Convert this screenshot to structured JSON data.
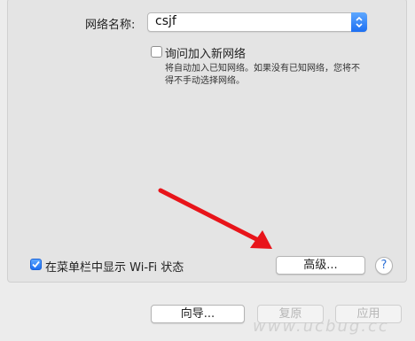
{
  "network": {
    "name_label": "网络名称:",
    "ssid_value": "csjf",
    "ask_to_join_label": "询问加入新网络",
    "ask_to_join_checked": false,
    "ask_to_join_description": "将自动加入已知网络。如果没有已知网络，您将不得不手动选择网络。"
  },
  "footer": {
    "show_wifi_label": "在菜单栏中显示 Wi-Fi 状态",
    "show_wifi_checked": true,
    "advanced_button": "高级...",
    "help_button": "?"
  },
  "bottom_bar": {
    "assist_button": "向导...",
    "revert_button": "复原",
    "apply_button": "应用"
  },
  "annotation": {
    "arrow_color": "#e8141a"
  },
  "watermark": {
    "text": "www.ucbug.cc"
  },
  "colors": {
    "accent": "#1c6ff2",
    "window_bg": "#ececec"
  }
}
